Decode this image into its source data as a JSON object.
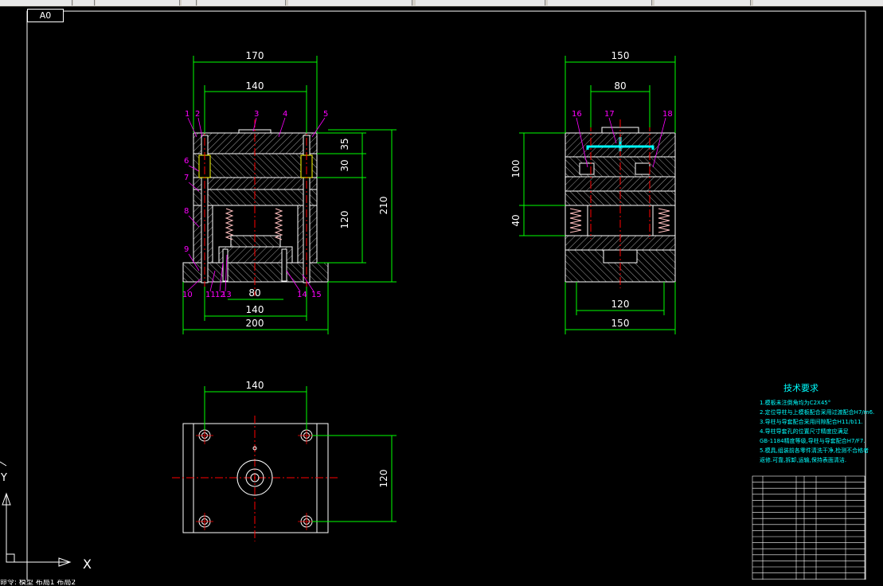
{
  "app": {
    "layout_tab": "A0"
  },
  "colors": {
    "background": "#000000",
    "outline": "#ffffff",
    "dimension": "#00ff00",
    "centerline": "#ff0000",
    "part_label": "#ff00ff",
    "hatch": "#00ffff",
    "spring": "#ffbfbf",
    "text_cyan": "#00ffff"
  },
  "front_view": {
    "dims_top": [
      "170",
      "140"
    ],
    "dims_right": [
      "35",
      "30",
      "120",
      "210"
    ],
    "dims_bottom": [
      "80",
      "140",
      "200"
    ],
    "part_labels": [
      "1",
      "2",
      "3",
      "4",
      "5",
      "6",
      "7",
      "8",
      "9",
      "10",
      "11",
      "12",
      "13",
      "14",
      "15"
    ]
  },
  "side_view": {
    "dims_top": [
      "150",
      "80"
    ],
    "dims_left": [
      "100",
      "40"
    ],
    "dims_bottom": [
      "120",
      "150"
    ],
    "part_labels": [
      "16",
      "17",
      "18"
    ]
  },
  "top_view": {
    "dims": [
      "140",
      "120"
    ]
  },
  "tech_requirements": {
    "title": "技术要求",
    "lines": [
      "1.模板未注倒角均为C2X45°",
      "2.定位导柱与上模板配合采用过渡配合H7/m6.",
      "3.导柱与导套配合采用间隙配合H11/b11.",
      "4.导柱导套孔的位置尺寸精度应满足",
      "  GB-1184精度等级,导柱与导套配合H7/F7.",
      "5.模具,组装前各零件清洗干净,检测不合格者",
      "  返修.可靠,拆卸,运输,保持表面清洁."
    ]
  },
  "ucs": {
    "x_label": "X",
    "y_label": "Y"
  },
  "status_text": "命令: 模型 布局1 布局2"
}
